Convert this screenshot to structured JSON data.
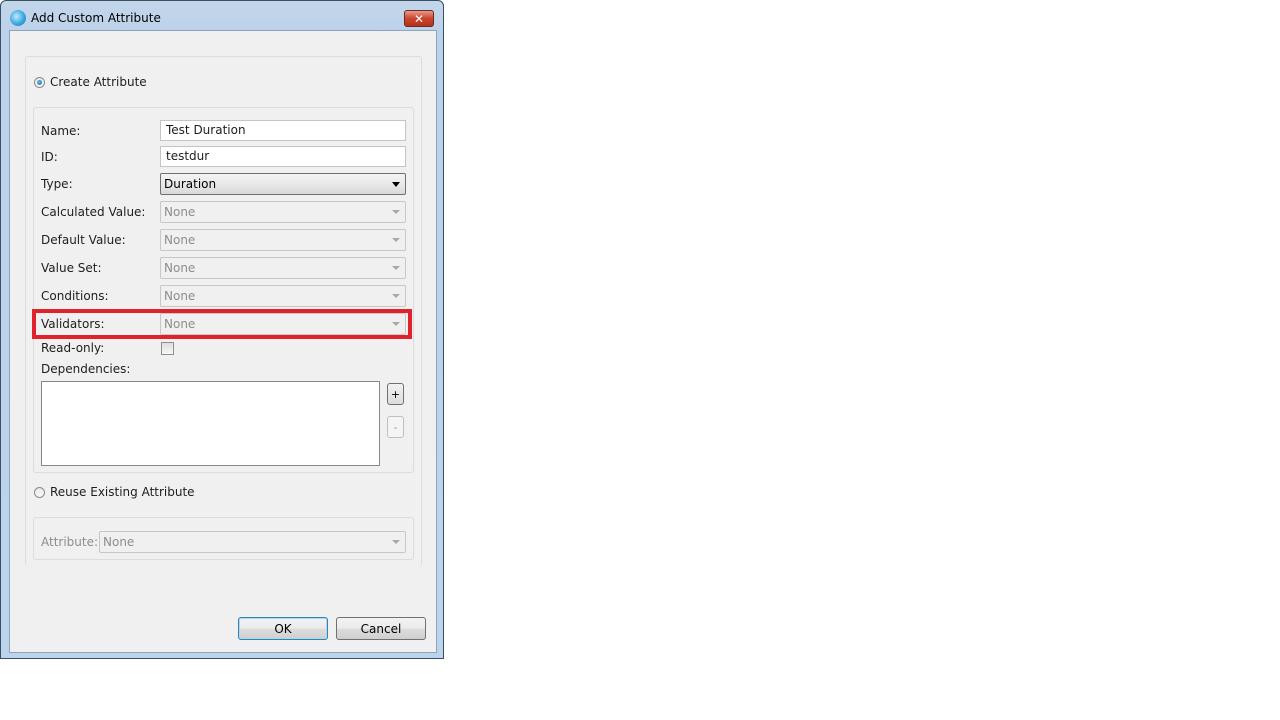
{
  "window": {
    "title": "Add Custom Attribute",
    "close_label": "✕"
  },
  "create_option": {
    "label": "Create Attribute",
    "selected": true,
    "fields": {
      "name": {
        "label": "Name:",
        "value": "Test Duration"
      },
      "id": {
        "label": "ID:",
        "value": "testdur"
      },
      "type": {
        "label": "Type:",
        "value": "Duration"
      },
      "calculated_value": {
        "label": "Calculated Value:",
        "value": "None"
      },
      "default_value": {
        "label": "Default Value:",
        "value": "None"
      },
      "value_set": {
        "label": "Value Set:",
        "value": "None"
      },
      "conditions": {
        "label": "Conditions:",
        "value": "None"
      },
      "validators": {
        "label": "Validators:",
        "value": "None"
      },
      "read_only": {
        "label": "Read-only:",
        "checked": false
      },
      "dependencies": {
        "label": "Dependencies:",
        "items": [],
        "add_label": "+",
        "remove_label": "-"
      }
    }
  },
  "reuse_option": {
    "label": "Reuse Existing Attribute",
    "selected": false,
    "attribute": {
      "label": "Attribute:",
      "value": "None"
    }
  },
  "highlight": {
    "target": "validators",
    "color": "#e0222c"
  },
  "buttons": {
    "ok": "OK",
    "cancel": "Cancel"
  }
}
